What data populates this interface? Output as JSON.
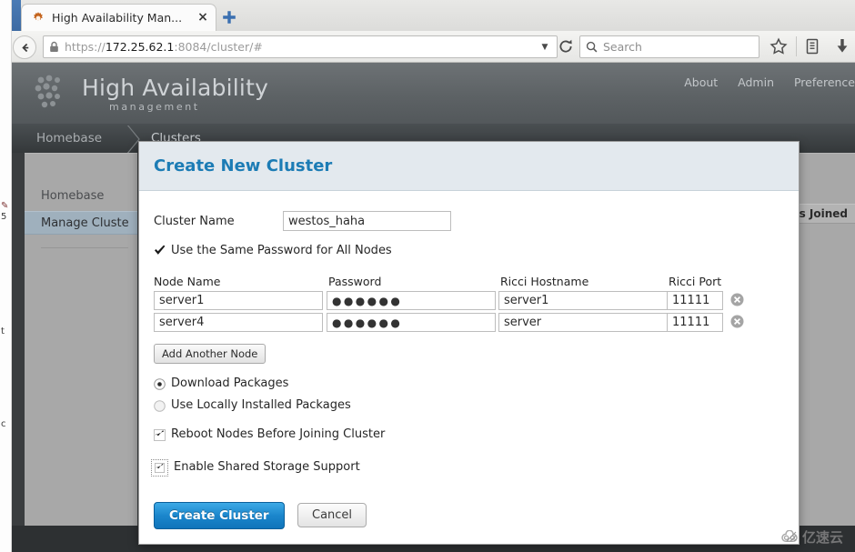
{
  "browser": {
    "tab": {
      "title": "High Availability Man...",
      "favicon": "gear-icon",
      "close_label": "×"
    },
    "newtab_label": "+",
    "url": {
      "scheme": "https://",
      "host": "172.25.62.1",
      "path": ":8084/cluster/#",
      "full": "https://172.25.62.1:8084/cluster/#"
    },
    "search": {
      "placeholder": "Search"
    },
    "toolbar": {
      "back": "back-icon",
      "reload": "reload-icon",
      "bookmark": "star-icon",
      "library": "library-icon",
      "downloads": "download-icon"
    }
  },
  "app": {
    "brand": "High Availability",
    "brand_sub": "management",
    "header_links": [
      "About",
      "Admin",
      "Preference"
    ],
    "nav_tabs": [
      {
        "label": "Homebase",
        "active": false
      },
      {
        "label": "Clusters",
        "active": true
      }
    ],
    "sidebar": {
      "items": [
        {
          "label": "Homebase",
          "selected": false
        },
        {
          "label": "Manage Cluste",
          "selected": true
        }
      ]
    },
    "table": {
      "column_header": "odes Joined"
    }
  },
  "modal": {
    "title": "Create New Cluster",
    "cluster_name": {
      "label": "Cluster Name",
      "value": "westos_haha"
    },
    "same_password": {
      "label": "Use the Same Password for All Nodes",
      "checked": true
    },
    "node_table": {
      "headers": {
        "node_name": "Node Name",
        "password": "Password",
        "ricci_hostname": "Ricci Hostname",
        "ricci_port": "Ricci Port"
      },
      "rows": [
        {
          "node_name": "server1",
          "password_mask": "●●●●●●",
          "ricci_hostname": "server1",
          "ricci_port": "11111",
          "delete_icon": "remove-circle-icon"
        },
        {
          "node_name": "server4",
          "password_mask": "●●●●●●",
          "ricci_hostname": "server",
          "ricci_port": "11111",
          "delete_icon": "remove-circle-icon"
        }
      ]
    },
    "add_node_label": "Add Another Node",
    "package_options": [
      {
        "label": "Download Packages",
        "selected": true
      },
      {
        "label": "Use Locally Installed Packages",
        "selected": false
      }
    ],
    "reboot": {
      "label": "Reboot Nodes Before Joining Cluster",
      "checked": true
    },
    "shared_storage": {
      "label": "Enable Shared Storage Support",
      "checked": true,
      "focused": true
    },
    "create_label": "Create Cluster",
    "cancel_label": "Cancel"
  },
  "watermark": {
    "text": "亿速云",
    "icon": "cloud-icon"
  },
  "colors": {
    "modal_title": "#1c7cb5",
    "modal_header_bg": "#e3e9ee",
    "primary_button": "#1b86cc",
    "app_header": "#5d6265",
    "sidebar_bg": "#a8a8a8",
    "selected_item": "#9fb0bd"
  }
}
